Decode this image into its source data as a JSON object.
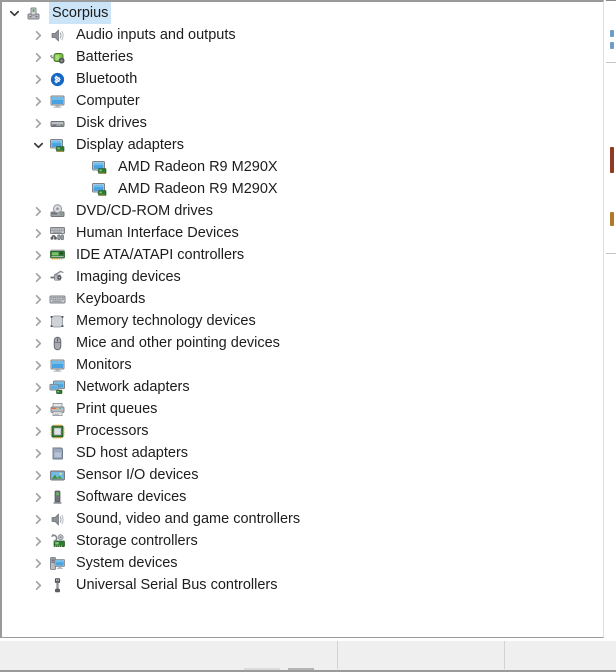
{
  "window": {
    "app": "Device Manager",
    "tree_root_selected": true
  },
  "tree": {
    "nodes": [
      {
        "label": "Scorpius",
        "level": 0,
        "state": "expanded",
        "icon": "computer-tower-icon",
        "selected": true
      },
      {
        "label": "Audio inputs and outputs",
        "level": 1,
        "state": "collapsed",
        "icon": "speaker-icon",
        "selected": false
      },
      {
        "label": "Batteries",
        "level": 1,
        "state": "collapsed",
        "icon": "battery-icon",
        "selected": false
      },
      {
        "label": "Bluetooth",
        "level": 1,
        "state": "collapsed",
        "icon": "bluetooth-icon",
        "selected": false
      },
      {
        "label": "Computer",
        "level": 1,
        "state": "collapsed",
        "icon": "monitor-icon",
        "selected": false
      },
      {
        "label": "Disk drives",
        "level": 1,
        "state": "collapsed",
        "icon": "disk-drive-icon",
        "selected": false
      },
      {
        "label": "Display adapters",
        "level": 1,
        "state": "expanded",
        "icon": "display-adapter-icon",
        "selected": false
      },
      {
        "label": "AMD Radeon R9 M290X",
        "level": 2,
        "state": "leaf",
        "icon": "display-adapter-icon",
        "selected": false
      },
      {
        "label": "AMD Radeon R9 M290X",
        "level": 2,
        "state": "leaf",
        "icon": "display-adapter-icon",
        "selected": false
      },
      {
        "label": "DVD/CD-ROM drives",
        "level": 1,
        "state": "collapsed",
        "icon": "optical-drive-icon",
        "selected": false
      },
      {
        "label": "Human Interface Devices",
        "level": 1,
        "state": "collapsed",
        "icon": "hid-icon",
        "selected": false
      },
      {
        "label": "IDE ATA/ATAPI controllers",
        "level": 1,
        "state": "collapsed",
        "icon": "ide-controller-icon",
        "selected": false
      },
      {
        "label": "Imaging devices",
        "level": 1,
        "state": "collapsed",
        "icon": "camera-icon",
        "selected": false
      },
      {
        "label": "Keyboards",
        "level": 1,
        "state": "collapsed",
        "icon": "keyboard-icon",
        "selected": false
      },
      {
        "label": "Memory technology devices",
        "level": 1,
        "state": "collapsed",
        "icon": "memory-device-icon",
        "selected": false
      },
      {
        "label": "Mice and other pointing devices",
        "level": 1,
        "state": "collapsed",
        "icon": "mouse-icon",
        "selected": false
      },
      {
        "label": "Monitors",
        "level": 1,
        "state": "collapsed",
        "icon": "monitor-icon",
        "selected": false
      },
      {
        "label": "Network adapters",
        "level": 1,
        "state": "collapsed",
        "icon": "network-adapter-icon",
        "selected": false
      },
      {
        "label": "Print queues",
        "level": 1,
        "state": "collapsed",
        "icon": "printer-icon",
        "selected": false
      },
      {
        "label": "Processors",
        "level": 1,
        "state": "collapsed",
        "icon": "processor-chip-icon",
        "selected": false
      },
      {
        "label": "SD host adapters",
        "level": 1,
        "state": "collapsed",
        "icon": "sd-card-icon",
        "selected": false
      },
      {
        "label": "Sensor I/O devices",
        "level": 1,
        "state": "collapsed",
        "icon": "sensor-icon",
        "selected": false
      },
      {
        "label": "Software devices",
        "level": 1,
        "state": "collapsed",
        "icon": "software-device-icon",
        "selected": false
      },
      {
        "label": "Sound, video and game controllers",
        "level": 1,
        "state": "collapsed",
        "icon": "speaker-icon",
        "selected": false
      },
      {
        "label": "Storage controllers",
        "level": 1,
        "state": "collapsed",
        "icon": "storage-controller-icon",
        "selected": false
      },
      {
        "label": "System devices",
        "level": 1,
        "state": "collapsed",
        "icon": "system-device-icon",
        "selected": false
      },
      {
        "label": "Universal Serial Bus controllers",
        "level": 1,
        "state": "collapsed",
        "icon": "usb-icon",
        "selected": false
      }
    ]
  },
  "statusbar": {
    "pane1": "",
    "pane2": "",
    "pane3": ""
  },
  "colors": {
    "selection": "#cce4f7",
    "text": "#1c1c1c",
    "chevron": "#a0a0a0",
    "panel_border": "#9a9a9a",
    "statusbar_bg": "#efefef"
  }
}
